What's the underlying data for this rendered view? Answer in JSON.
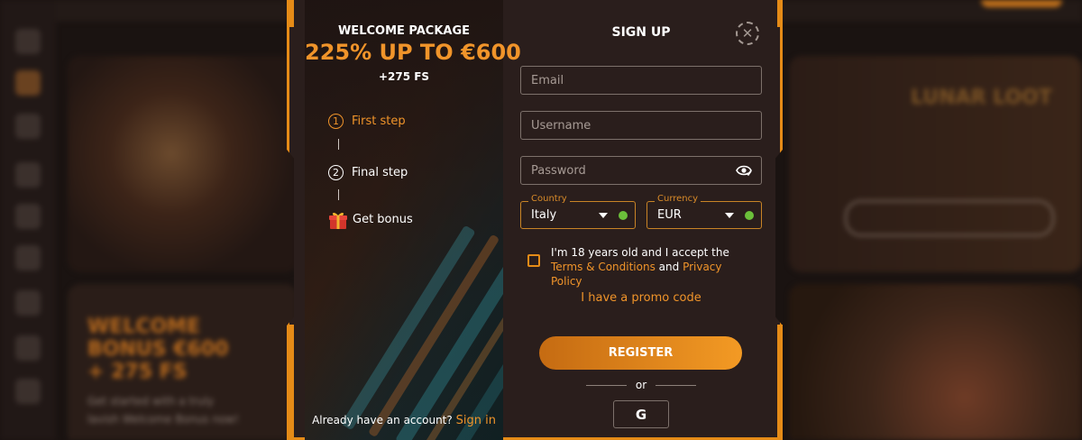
{
  "colors": {
    "accent": "#f0942a",
    "frame": "#e58b17",
    "modal_bg": "#2a1e1c",
    "success": "#6bbf3a"
  },
  "background_page": {
    "left_card_heading": "WELCOME BONUS €600 + 275 FS",
    "left_card_text": "Get started with a truly lavish Welcome Bonus now!",
    "right_card_heading": "LUNAR LOOT"
  },
  "promo": {
    "title": "WELCOME PACKAGE",
    "amount": "225% UP TO €600",
    "free_spins": "+275 FS",
    "steps": [
      {
        "number": "1",
        "label": "First step"
      },
      {
        "number": "2",
        "label": "Final step"
      },
      {
        "label": "Get bonus",
        "icon": "gift-icon"
      }
    ],
    "signin_prompt": "Already have an account?",
    "signin_link": "Sign in"
  },
  "form": {
    "title": "SIGN UP",
    "close_icon": "close-icon",
    "email": {
      "placeholder": "Email",
      "value": ""
    },
    "username": {
      "placeholder": "Username",
      "value": ""
    },
    "password": {
      "placeholder": "Password",
      "value": "",
      "toggle_icon": "eye-icon"
    },
    "country": {
      "legend": "Country",
      "value": "Italy"
    },
    "currency": {
      "legend": "Currency",
      "value": "EUR"
    },
    "terms_prefix": "I'm 18 years old and I accept the ",
    "terms_link": "Terms & Conditions",
    "terms_and": " and ",
    "privacy_link": "Privacy Policy",
    "promo_code_link": "I have a promo code",
    "register_label": "REGISTER",
    "or_label": "or",
    "google_label": "G"
  }
}
